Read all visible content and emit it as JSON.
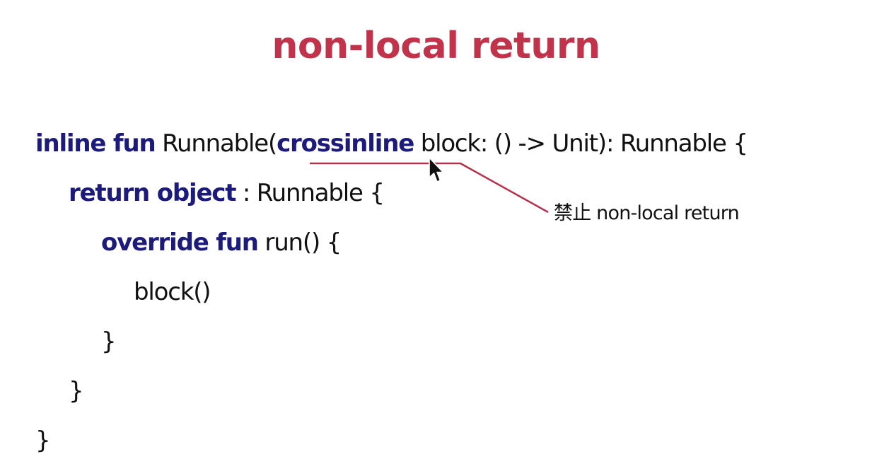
{
  "slide": {
    "title": "non-local return",
    "code": {
      "line1": {
        "kw1": "inline fun",
        "text1": " Runnable(",
        "kw2": "crossinline",
        "text2": " block: () -> Unit): Runnable {"
      },
      "line2": {
        "kw1": "return object",
        "text1": " : Runnable {"
      },
      "line3": {
        "kw1": "override fun",
        "text1": " run() {"
      },
      "line4": {
        "text1": "block()"
      },
      "line5": {
        "text1": "}"
      },
      "line6": {
        "text1": "}"
      },
      "line7": {
        "text1": "}"
      }
    },
    "annotation": "禁止 non-local return"
  },
  "colors": {
    "title": "#c0334a",
    "keyword": "#1c1a7a",
    "callout_line": "#b5324a"
  },
  "icons": {
    "cursor": "mouse-pointer-icon"
  }
}
